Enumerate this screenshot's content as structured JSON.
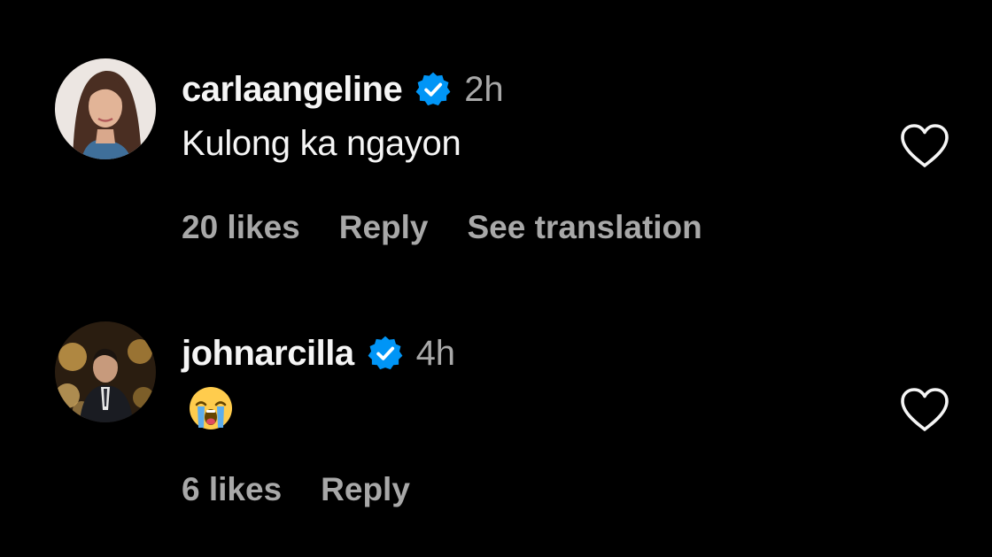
{
  "colors": {
    "background": "#000000",
    "primary_text": "#f5f5f5",
    "secondary_text": "#a8a8a8",
    "verified_blue": "#0095f6"
  },
  "comments": [
    {
      "username": "carlaangeline",
      "verified": true,
      "timestamp": "2h",
      "text": "Kulong ka ngayon",
      "likes_label": "20 likes",
      "reply_label": "Reply",
      "translation_label": "See translation",
      "like_icon": "heart-outline-icon"
    },
    {
      "username": "johnarcilla",
      "verified": true,
      "timestamp": "4h",
      "emoji": "loudly-crying-face",
      "likes_label": "6 likes",
      "reply_label": "Reply",
      "like_icon": "heart-outline-icon"
    }
  ]
}
